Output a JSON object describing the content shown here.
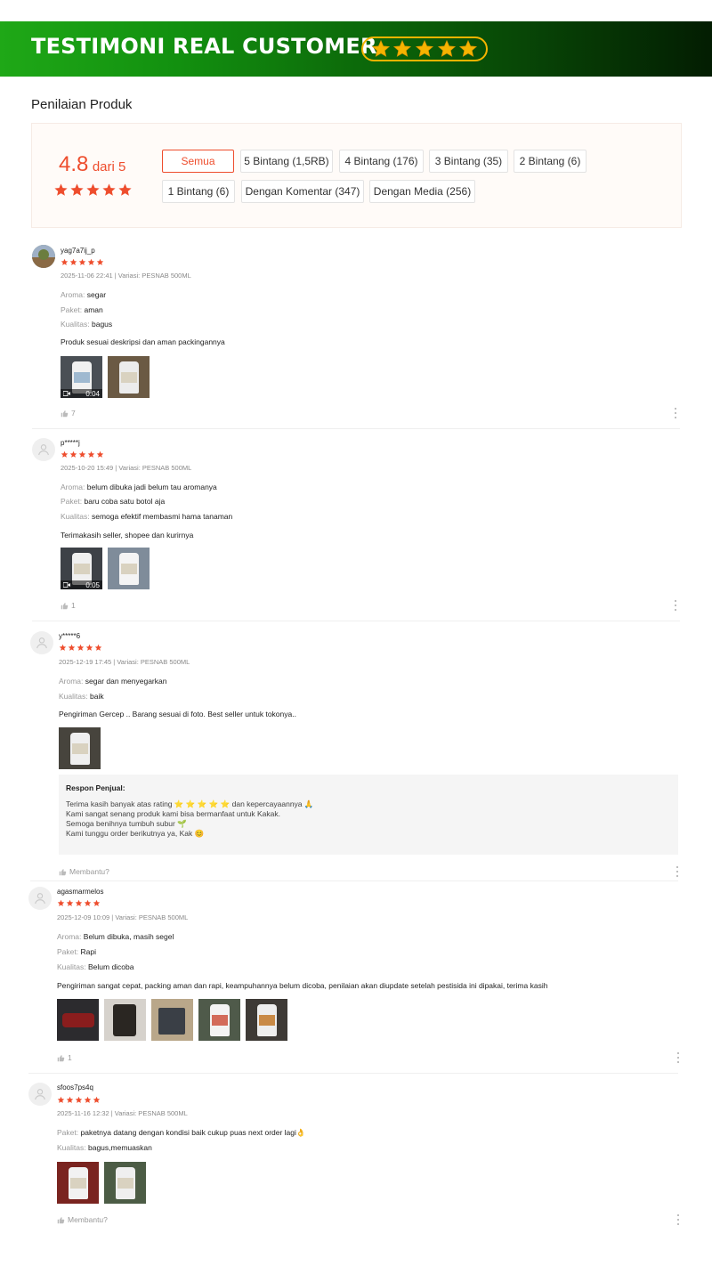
{
  "banner": {
    "title": "TESTIMONI REAL CUSTOMER",
    "star_color": "#f5b400",
    "accent": "#1fa817"
  },
  "page_title": "Penilaian Produk",
  "overview": {
    "score": "4.8",
    "score_suffix": "dari 5",
    "stars": 5,
    "filters": [
      "Semua",
      "5 Bintang (1,5RB)",
      "4 Bintang (176)",
      "3 Bintang (35)",
      "2 Bintang (6)",
      "1 Bintang (6)",
      "Dengan Komentar (347)",
      "Dengan Media (256)"
    ]
  },
  "reviews": [
    {
      "username": "yag7a7ij_p",
      "stars": 5,
      "meta": "2025-11-06 22:41 | Variasi: PESNAB 500ML",
      "attrs": [
        {
          "k": "Aroma:",
          "v": "segar"
        },
        {
          "k": "Paket:",
          "v": "aman"
        },
        {
          "k": "Kualitas:",
          "v": "bagus"
        }
      ],
      "comment": "Produk sesuai deskripsi dan aman packingannya",
      "video_duration": "0:04",
      "likes": "7"
    },
    {
      "username": "p*****j",
      "stars": 5,
      "meta": "2025-10-20 15:49 | Variasi: PESNAB 500ML",
      "attrs": [
        {
          "k": "Aroma:",
          "v": "belum dibuka jadi belum tau aromanya"
        },
        {
          "k": "Paket:",
          "v": "baru coba satu botol aja"
        },
        {
          "k": "Kualitas:",
          "v": "semoga efektif membasmi hama tanaman"
        }
      ],
      "comment": "Terimakasih seller, shopee dan kurirnya",
      "video_duration": "0:05",
      "likes": "1"
    },
    {
      "username": "y*****6",
      "stars": 5,
      "meta": "2025-12-19 17:45 | Variasi: PESNAB 500ML",
      "attrs": [
        {
          "k": "Aroma:",
          "v": "segar dan menyegarkan"
        },
        {
          "k": "Kualitas:",
          "v": "baik"
        }
      ],
      "comment": "Pengiriman Gercep .. Barang sesuai di foto. Best seller untuk tokonya..",
      "seller_response": {
        "title": "Respon Penjual:",
        "lines": [
          "Terima kasih banyak atas rating ⭐ ⭐ ⭐ ⭐ ⭐ dan kepercayaannya 🙏",
          "Kami sangat senang produk kami bisa bermanfaat untuk Kakak.",
          "Semoga benihnya tumbuh subur 🌱",
          "Kami tunggu order berikutnya ya, Kak 😊"
        ]
      },
      "likes": "Membantu?"
    },
    {
      "username": "agasmarmelos",
      "stars": 5,
      "meta": "2025-12-09 10:09 | Variasi: PESNAB 500ML",
      "attrs": [
        {
          "k": "Aroma:",
          "v": "Belum dibuka, masih segel"
        },
        {
          "k": "Paket:",
          "v": "Rapi"
        },
        {
          "k": "Kualitas:",
          "v": "Belum dicoba"
        }
      ],
      "comment": "Pengiriman sangat cepat, packing aman dan rapi, keampuhannya belum dicoba, penilaian akan diupdate setelah pestisida ini dipakai,  terima kasih",
      "likes": "1"
    },
    {
      "username": "sfoos7ps4q",
      "stars": 5,
      "meta": "2025-11-16 12:32 | Variasi: PESNAB 500ML",
      "attrs": [
        {
          "k": "Paket:",
          "v": "paketnya datang dengan kondisi baik cukup puas next order lagi👌"
        },
        {
          "k": "Kualitas:",
          "v": "bagus,memuaskan"
        }
      ],
      "likes": "Membantu?"
    }
  ]
}
